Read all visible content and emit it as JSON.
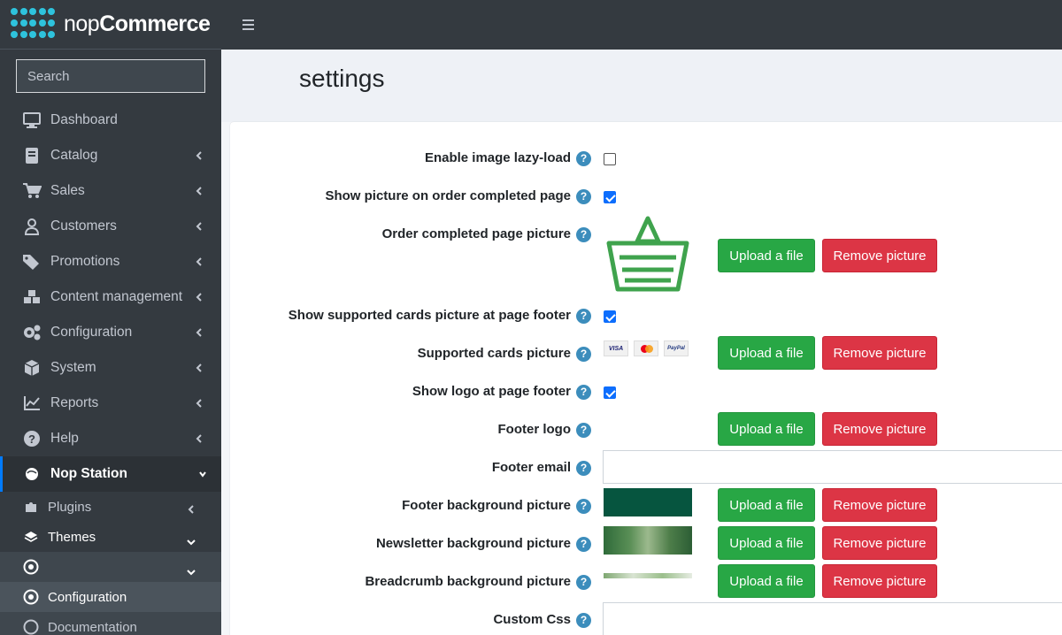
{
  "brand": {
    "prefix": "nop",
    "name": "Commerce"
  },
  "search": {
    "placeholder": "Search"
  },
  "nav": [
    {
      "label": "Dashboard",
      "icon": "monitor-icon",
      "chevron": false
    },
    {
      "label": "Catalog",
      "icon": "book-icon",
      "chevron": true
    },
    {
      "label": "Sales",
      "icon": "cart-icon",
      "chevron": true
    },
    {
      "label": "Customers",
      "icon": "user-icon",
      "chevron": true
    },
    {
      "label": "Promotions",
      "icon": "tags-icon",
      "chevron": true
    },
    {
      "label": "Content management",
      "icon": "cubes-icon",
      "chevron": true
    },
    {
      "label": "Configuration",
      "icon": "gears-icon",
      "chevron": true
    },
    {
      "label": "System",
      "icon": "cube-icon",
      "chevron": true
    },
    {
      "label": "Reports",
      "icon": "chart-icon",
      "chevron": true
    },
    {
      "label": "Help",
      "icon": "question-icon",
      "chevron": true
    },
    {
      "label": "Nop Station",
      "icon": "nopstation-icon",
      "chevron": true
    }
  ],
  "subnav": [
    {
      "label": "Plugins",
      "icon": "puzzle-icon"
    },
    {
      "label": "Themes",
      "icon": "layers-icon"
    },
    {
      "label": "",
      "icon": "dot-circle-icon"
    },
    {
      "label": "Configuration",
      "icon": "dot-circle-icon"
    },
    {
      "label": "Documentation",
      "icon": "circle-icon"
    }
  ],
  "page": {
    "title": "settings"
  },
  "buttons": {
    "upload": "Upload a file",
    "remove": "Remove picture"
  },
  "fields": {
    "lazy_load": {
      "label": "Enable image lazy-load",
      "checked": false
    },
    "show_order_picture": {
      "label": "Show picture on order completed page",
      "checked": true
    },
    "order_picture": {
      "label": "Order completed page picture"
    },
    "show_cards": {
      "label": "Show supported cards picture at page footer",
      "checked": true
    },
    "cards_picture": {
      "label": "Supported cards picture",
      "cards": [
        "VISA",
        "PayPal"
      ]
    },
    "show_logo": {
      "label": "Show logo at page footer",
      "checked": true
    },
    "footer_logo": {
      "label": "Footer logo"
    },
    "footer_email": {
      "label": "Footer email",
      "value": ""
    },
    "footer_bg": {
      "label": "Footer background picture"
    },
    "newsletter_bg": {
      "label": "Newsletter background picture"
    },
    "breadcrumb_bg": {
      "label": "Breadcrumb background picture"
    },
    "custom_css": {
      "label": "Custom Css",
      "value": ""
    }
  },
  "colors": {
    "sidebar": "#343a40",
    "upload": "#28a745",
    "remove": "#dc3545",
    "help": "#3c8dbc",
    "footer_bg": "#06553f"
  }
}
